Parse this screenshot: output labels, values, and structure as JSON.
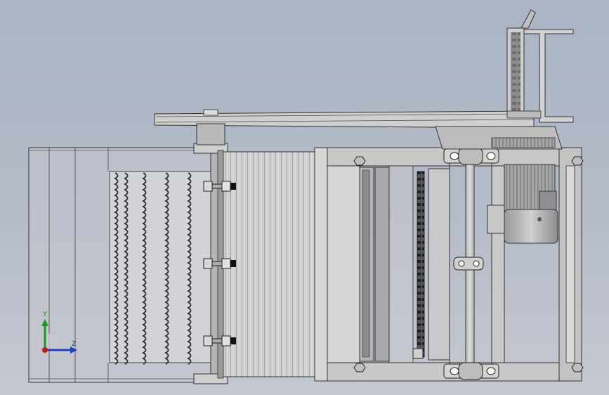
{
  "view": {
    "background_top": "#aab4c4",
    "background_bottom": "#c4c8d0",
    "model_fill": "#c9c9c9",
    "model_dark": "#8a8a8a",
    "model_edge": "#2b2b2b"
  },
  "triad": {
    "y_label": "Y",
    "z_label": "Z",
    "y_color": "#1a9a1a",
    "z_color": "#2040c0",
    "x_color": "#c01818"
  }
}
